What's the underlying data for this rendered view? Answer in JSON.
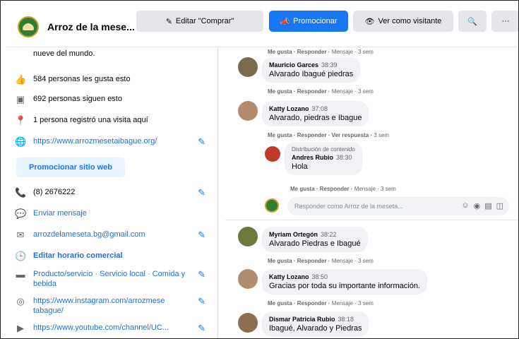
{
  "header": {
    "page_name": "Arroz de la mese...",
    "edit_label": "Editar \"Comprar\"",
    "promote_label": "Promocionar",
    "visitor_label": "Ver como visitante"
  },
  "left": {
    "intro_text": "nueve del mundo.",
    "likes": "584 personas les gusta esto",
    "followers": "692 personas siguen esto",
    "checkins": "1 persona registró una visita aquí",
    "website": "https://www.arrozmesetaibague.org/",
    "promote_web": "Promocionar sitio web",
    "phone": "(8) 2676222",
    "message": "Enviar mensaje",
    "email": "arrozdelameseta.bg@gmail.com",
    "hours": "Editar horario comercial",
    "category": "Producto/servicio · Servicio local · Comida y bebida",
    "instagram": "https://www.instagram.com/arrozmese tabague/",
    "youtube": "https://www.youtube.com/channel/UC..."
  },
  "comments": [
    {
      "author": "Mauricio Garces",
      "time": "38:39",
      "text": "Alvarado Ibagué piedras",
      "actions": "Me gusta · Responder",
      "meta": "Mensaje · 3 sem"
    },
    {
      "author": "Katty Lozano",
      "time": "37:08",
      "text": "Alvarado, piedras e Ibague",
      "actions": "Me gusta · Responder · Ver respuesta",
      "meta": "3 sem"
    },
    {
      "tag": "Distribución de contenido",
      "author": "Andres Rubio",
      "time": "38:30",
      "text": "Hola",
      "actions": "Me gusta · Responder",
      "meta": "Mensaje · 3 sem"
    },
    {
      "author": "Myriam Ortegón",
      "time": "38:22",
      "text": "Alvarado Piedras e Ibagué",
      "actions": "Me gusta · Responder",
      "meta": "Mensaje · 3 sem"
    },
    {
      "author": "Katty Lozano",
      "time": "38:50",
      "text": "Gracias por toda su importante información.",
      "actions": "Me gusta · Responder",
      "meta": "Mensaje · 3 sem"
    },
    {
      "author": "Dismar Patricia Rubio",
      "time": "38:18",
      "text": "Ibagué, Alvarado y Piedras",
      "actions": "",
      "meta": ""
    }
  ],
  "top_actions": {
    "actions": "Me gusta · Responder",
    "meta": "Mensaje · 3 sem"
  },
  "reply_placeholder": "Responder como Arroz de la meseta...",
  "colors": {
    "accent": "#1877f2",
    "bubble": "#f0f2f5"
  }
}
